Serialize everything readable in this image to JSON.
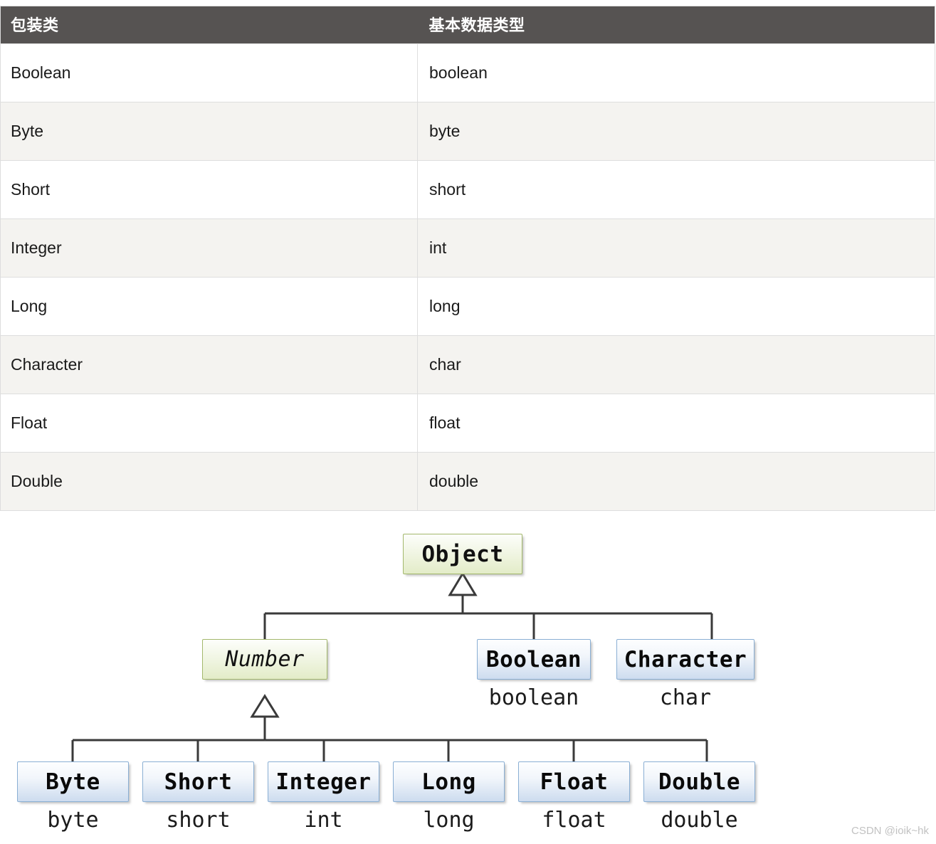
{
  "table": {
    "columns": [
      "包装类",
      "基本数据类型"
    ],
    "rows": [
      {
        "wrapper": "Boolean",
        "primitive": "boolean"
      },
      {
        "wrapper": "Byte",
        "primitive": "byte"
      },
      {
        "wrapper": "Short",
        "primitive": "short"
      },
      {
        "wrapper": "Integer",
        "primitive": "int"
      },
      {
        "wrapper": "Long",
        "primitive": "long"
      },
      {
        "wrapper": "Character",
        "primitive": "char"
      },
      {
        "wrapper": "Float",
        "primitive": "float"
      },
      {
        "wrapper": "Double",
        "primitive": "double"
      }
    ]
  },
  "diagram": {
    "root": {
      "label": "Object",
      "style": "green"
    },
    "level2": [
      {
        "label": "Number",
        "style": "green",
        "italic": true,
        "primitive": ""
      },
      {
        "label": "Boolean",
        "style": "blue",
        "italic": false,
        "primitive": "boolean"
      },
      {
        "label": "Character",
        "style": "blue",
        "italic": false,
        "primitive": "char"
      }
    ],
    "level3": [
      {
        "label": "Byte",
        "style": "blue",
        "primitive": "byte"
      },
      {
        "label": "Short",
        "style": "blue",
        "primitive": "short"
      },
      {
        "label": "Integer",
        "style": "blue",
        "primitive": "int"
      },
      {
        "label": "Long",
        "style": "blue",
        "primitive": "long"
      },
      {
        "label": "Float",
        "style": "blue",
        "primitive": "float"
      },
      {
        "label": "Double",
        "style": "blue",
        "primitive": "double"
      }
    ]
  },
  "watermark": {
    "text": "CSDN @ioik~hk"
  },
  "colors": {
    "header_bg": "#565352",
    "row_alt_bg": "#f4f3f0",
    "border": "#dedede",
    "green_border": "#a3b86c",
    "green_fill": "#e3ecc8",
    "blue_border": "#8aafd4",
    "blue_fill": "#cddcef",
    "line": "#3a3a3a"
  }
}
